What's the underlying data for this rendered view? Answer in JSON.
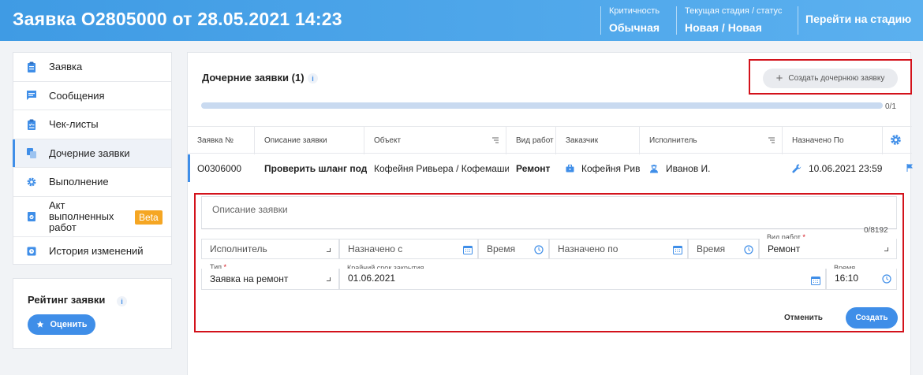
{
  "header": {
    "title": "Заявка О2805000 от 28.05.2021 14:23",
    "criticality_label": "Критичность",
    "criticality_value": "Обычная",
    "stage_label": "Текущая стадия / статус",
    "stage_value": "Новая / Новая",
    "go_to_stage": "Перейти на стадию"
  },
  "sidebar": {
    "items": [
      {
        "label": "Заявка",
        "icon": "clipboard-icon"
      },
      {
        "label": "Сообщения",
        "icon": "message-icon"
      },
      {
        "label": "Чек-листы",
        "icon": "checklist-icon"
      },
      {
        "label": "Дочерние заявки",
        "icon": "copy-icon"
      },
      {
        "label": "Выполнение",
        "icon": "gear-icon"
      },
      {
        "label": "Акт выполненных работ",
        "icon": "certificate-icon",
        "badge": "Beta"
      },
      {
        "label": "История изменений",
        "icon": "history-icon"
      }
    ],
    "rating": {
      "title": "Рейтинг заявки",
      "info": "i",
      "button": "Оценить"
    }
  },
  "section": {
    "title": "Дочерние заявки (1)",
    "info": "i",
    "create_button": "Создать дочернюю заявку",
    "progress_label": "0/1",
    "progress_fraction": 0
  },
  "table": {
    "columns": [
      "Заявка №",
      "Описание заявки",
      "Объект",
      "Вид работ",
      "Заказчик",
      "Исполнитель",
      "Назначено По"
    ],
    "rows": [
      [
        "О0306000",
        "Проверить шланг под м",
        "Кофейня Ривьера / Кофемаши",
        "Ремонт",
        "Кофейня Рив",
        "Иванов И.",
        "10.06.2021 23:59"
      ]
    ]
  },
  "form": {
    "description_placeholder": "Описание заявки",
    "description_counter": "0/8192",
    "executor_placeholder": "Исполнитель",
    "assigned_from_placeholder": "Назначено с",
    "time_placeholder": "Время",
    "assigned_to_placeholder": "Назначено по",
    "time2_placeholder": "Время",
    "work_type_label": "Вид работ",
    "work_type_value": "Ремонт",
    "type_label": "Тип",
    "type_value": "Заявка на ремонт",
    "deadline_label": "Крайний срок закрытия",
    "deadline_value": "01.06.2021",
    "deadline_time_label": "Время",
    "deadline_time_value": "16:10",
    "required_mark": "*",
    "cancel": "Отменить",
    "create": "Создать"
  },
  "colors": {
    "accent": "#3f8ee8",
    "header": "#4aa3ea",
    "highlight": "#d3121b",
    "beta": "#f5a623"
  }
}
